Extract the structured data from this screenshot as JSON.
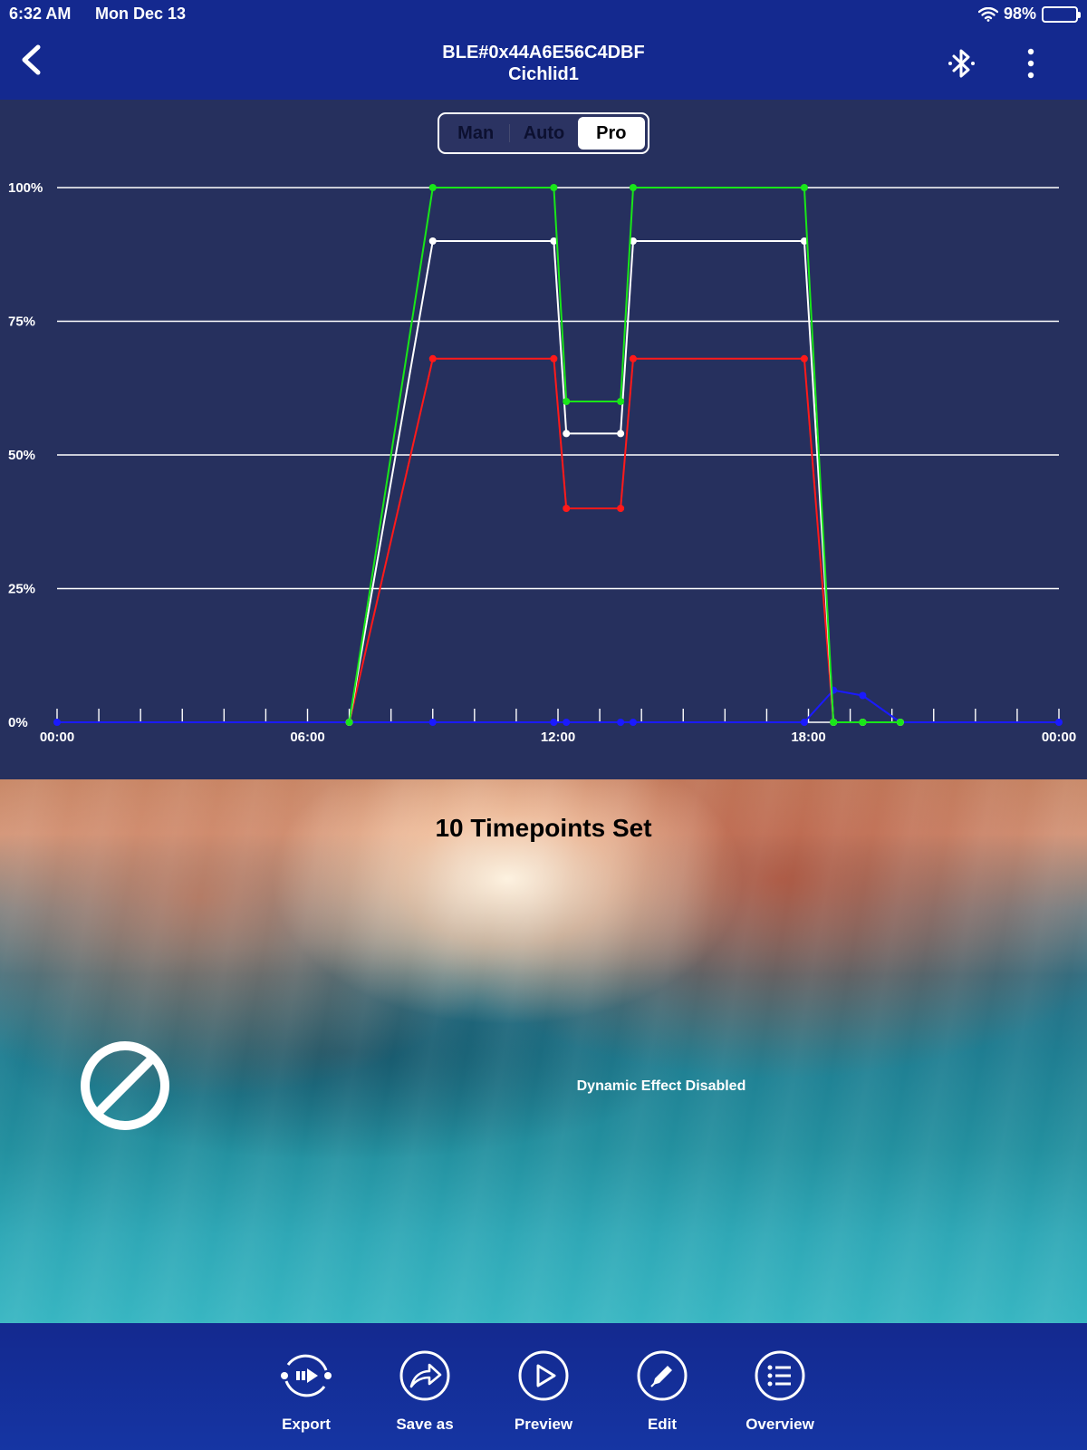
{
  "status_bar": {
    "time": "6:32 AM",
    "date": "Mon Dec 13",
    "battery": "98%"
  },
  "nav": {
    "device_id": "BLE#0x44A6E56C4DBF",
    "device_name": "Cichlid1",
    "back_icon": "chevron-left-icon",
    "bluetooth_icon": "bluetooth-icon",
    "more_icon": "more-vertical-icon"
  },
  "mode_tabs": [
    {
      "label": "Man",
      "active": false
    },
    {
      "label": "Auto",
      "active": false
    },
    {
      "label": "Pro",
      "active": true
    }
  ],
  "chart_data": {
    "type": "line",
    "x_ticks": [
      "00:00",
      "06:00",
      "12:00",
      "18:00",
      "00:00"
    ],
    "y_ticks": [
      "0%",
      "25%",
      "50%",
      "75%",
      "100%"
    ],
    "xlim": [
      0,
      24
    ],
    "ylim": [
      0,
      100
    ],
    "grid": true,
    "legend": "bottom-left",
    "series": [
      {
        "name": "Red",
        "color": "#ff1a1a",
        "points": [
          [
            7,
            0
          ],
          [
            9,
            68
          ],
          [
            11.9,
            68
          ],
          [
            12.2,
            40
          ],
          [
            13.5,
            40
          ],
          [
            13.8,
            68
          ],
          [
            17.9,
            68
          ],
          [
            18.6,
            0
          ],
          [
            19.3,
            0
          ],
          [
            20.2,
            0
          ]
        ]
      },
      {
        "name": "Green",
        "color": "#19e619",
        "points": [
          [
            7,
            0
          ],
          [
            9,
            100
          ],
          [
            11.9,
            100
          ],
          [
            12.2,
            60
          ],
          [
            13.5,
            60
          ],
          [
            13.8,
            100
          ],
          [
            17.9,
            100
          ],
          [
            18.6,
            0
          ],
          [
            19.3,
            0
          ],
          [
            20.2,
            0
          ]
        ]
      },
      {
        "name": "Blue",
        "color": "#1a1aff",
        "points": [
          [
            0,
            0
          ],
          [
            7,
            0
          ],
          [
            9,
            0
          ],
          [
            11.9,
            0
          ],
          [
            12.2,
            0
          ],
          [
            13.5,
            0
          ],
          [
            13.8,
            0
          ],
          [
            17.9,
            0
          ],
          [
            18.6,
            6
          ],
          [
            19.3,
            5
          ],
          [
            20.2,
            0
          ],
          [
            24,
            0
          ]
        ]
      },
      {
        "name": "White",
        "color": "#ffffff",
        "points": [
          [
            7,
            0
          ],
          [
            9,
            90
          ],
          [
            11.9,
            90
          ],
          [
            12.2,
            54
          ],
          [
            13.5,
            54
          ],
          [
            13.8,
            90
          ],
          [
            17.9,
            90
          ],
          [
            18.6,
            0
          ],
          [
            19.3,
            0
          ],
          [
            20.2,
            0
          ]
        ]
      }
    ]
  },
  "hero": {
    "title": "10 Timepoints Set",
    "status": "Dynamic Effect Disabled",
    "icon": "disabled-icon"
  },
  "toolbar": [
    {
      "label": "Export",
      "icon": "export-icon"
    },
    {
      "label": "Save as",
      "icon": "share-icon"
    },
    {
      "label": "Preview",
      "icon": "play-icon"
    },
    {
      "label": "Edit",
      "icon": "pencil-icon"
    },
    {
      "label": "Overview",
      "icon": "list-icon"
    }
  ]
}
